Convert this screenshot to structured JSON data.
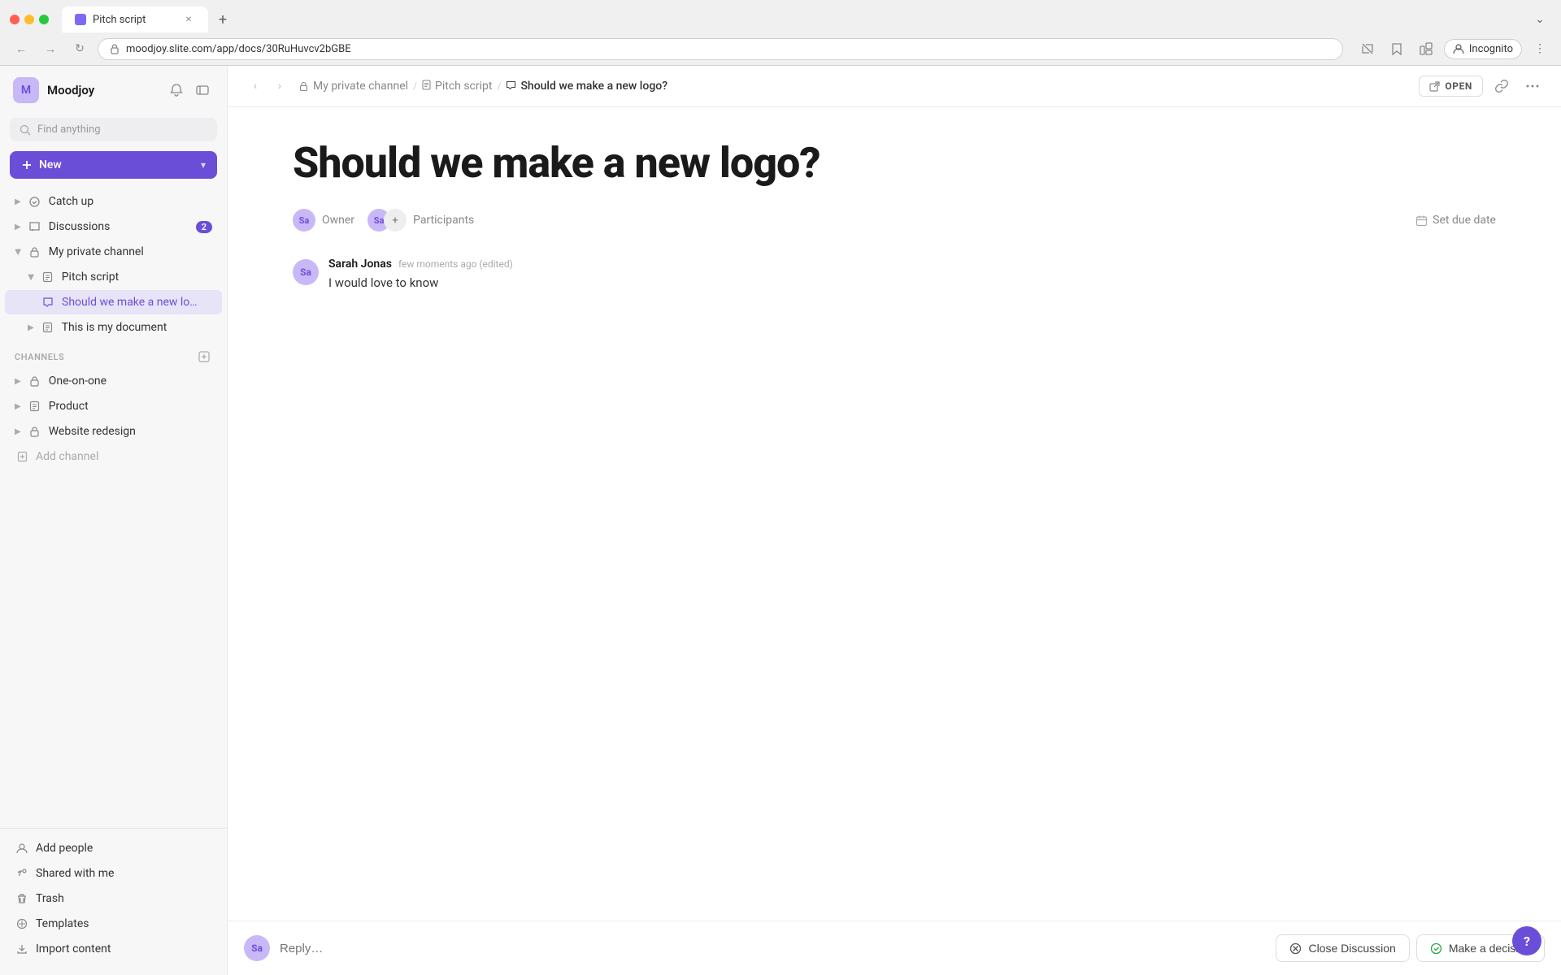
{
  "browser": {
    "tab_title": "Pitch script",
    "url": "moodjoy.slite.com/app/docs/30RuHuvcv2bGBE",
    "nav_back_label": "←",
    "nav_forward_label": "→",
    "nav_refresh_label": "↻",
    "profile_label": "Incognito",
    "new_tab_label": "+",
    "tab_chevron_down": "⌄"
  },
  "sidebar": {
    "workspace_name": "Moodjoy",
    "workspace_initials": "M",
    "search_placeholder": "Find anything",
    "new_button_label": "New",
    "nav_items": [
      {
        "id": "catch-up",
        "label": "Catch up",
        "icon": "dot",
        "indent": 0
      },
      {
        "id": "discussions",
        "label": "Discussions",
        "icon": "bubble",
        "indent": 0,
        "badge": "2"
      },
      {
        "id": "my-private-channel",
        "label": "My private channel",
        "icon": "lock",
        "indent": 0,
        "expanded": true
      },
      {
        "id": "pitch-script",
        "label": "Pitch script",
        "icon": "doc",
        "indent": 1,
        "expanded": true
      },
      {
        "id": "should-we-make",
        "label": "Should we make a new lo…",
        "icon": "bubble",
        "indent": 2,
        "active": true
      },
      {
        "id": "this-is-my-document",
        "label": "This is my document",
        "icon": "doc",
        "indent": 1
      }
    ],
    "channels_label": "Channels",
    "channels": [
      {
        "id": "one-on-one",
        "label": "One-on-one",
        "icon": "lock"
      },
      {
        "id": "product",
        "label": "Product",
        "icon": "doc"
      },
      {
        "id": "website-redesign",
        "label": "Website redesign",
        "icon": "lock"
      },
      {
        "id": "add-channel",
        "label": "Add channel",
        "icon": "plus-box"
      }
    ],
    "footer_items": [
      {
        "id": "add-people",
        "label": "Add people",
        "icon": "person"
      },
      {
        "id": "shared-with-me",
        "label": "Shared with me",
        "icon": "share"
      },
      {
        "id": "trash",
        "label": "Trash",
        "icon": "trash"
      },
      {
        "id": "templates",
        "label": "Templates",
        "icon": "template"
      },
      {
        "id": "import-content",
        "label": "Import content",
        "icon": "import"
      }
    ]
  },
  "topbar": {
    "breadcrumb_items": [
      {
        "id": "my-private-channel",
        "label": "My private channel",
        "icon": "lock"
      },
      {
        "id": "pitch-script",
        "label": "Pitch script",
        "icon": "doc"
      },
      {
        "id": "should-we-make",
        "label": "Should we make a new logo?",
        "icon": "discussion"
      }
    ],
    "open_button_label": "OPEN",
    "link_icon_label": "link",
    "more_icon_label": "more"
  },
  "discussion": {
    "title": "Should we make a new logo?",
    "owner_label": "Owner",
    "participants_label": "Participants",
    "owner_initials": "Sa",
    "participant_initials": "Sa",
    "set_due_date_label": "Set due date",
    "comment": {
      "author": "Sarah Jonas",
      "time": "few moments ago (edited)",
      "text": "I would love to know",
      "avatar_initials": "Sa"
    },
    "reply_placeholder": "Reply…"
  },
  "actions": {
    "close_discussion_label": "Close Discussion",
    "make_decision_label": "Make a decision"
  }
}
